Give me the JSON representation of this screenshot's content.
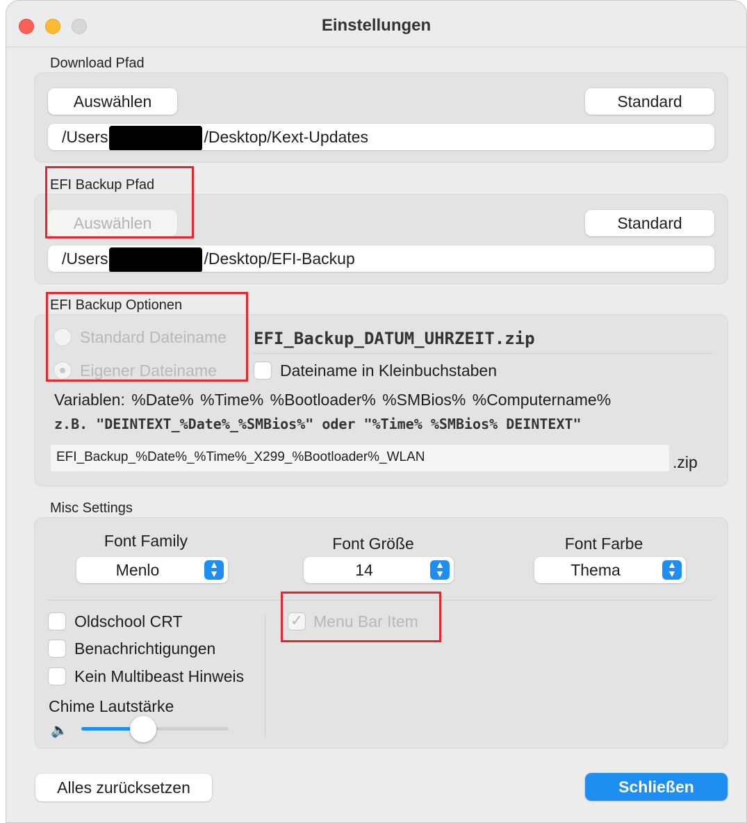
{
  "window": {
    "title": "Einstellungen"
  },
  "download": {
    "label": "Download Pfad",
    "choose_label": "Auswählen",
    "default_label": "Standard",
    "path_prefix": "/Users",
    "path_suffix": "/Desktop/Kext-Updates"
  },
  "efi_path": {
    "label": "EFI Backup Pfad",
    "choose_label": "Auswählen",
    "default_label": "Standard",
    "path_prefix": "/Users",
    "path_suffix": "/Desktop/EFI-Backup"
  },
  "efi_options": {
    "label": "EFI Backup Optionen",
    "radio_standard_label": "Standard Dateiname",
    "standard_filename": "EFI_Backup_DATUM_UHRZEIT.zip",
    "radio_custom_label": "Eigener Dateiname",
    "lowercase_label": "Dateiname in Kleinbuchstaben",
    "variables_text": "Variablen: %Date%  %Time%  %Bootloader%  %SMBios%  %Computername%",
    "example_text": "z.B. \"DEINTEXT_%Date%_%SMBios%\" oder \"%Time% %SMBios% DEINTEXT\"",
    "filename_value": "EFI_Backup_%Date%_%Time%_X299_%Bootloader%_WLAN",
    "extension": ".zip"
  },
  "misc": {
    "label": "Misc Settings",
    "font_family_label": "Font Family",
    "font_family_value": "Menlo",
    "font_size_label": "Font Größe",
    "font_size_value": "14",
    "font_color_label": "Font Farbe",
    "font_color_value": "Thema",
    "oldschool_label": "Oldschool CRT",
    "notifications_label": "Benachrichtigungen",
    "multibeast_label": "Kein Multibeast Hinweis",
    "menubar_label": "Menu Bar Item",
    "chime_label": "Chime Lautstärke",
    "chime_level": 0.4
  },
  "footer": {
    "reset_label": "Alles zurücksetzen",
    "close_label": "Schließen"
  },
  "colors": {
    "accent": "#1f8ef1",
    "highlight": "#e3262f"
  }
}
